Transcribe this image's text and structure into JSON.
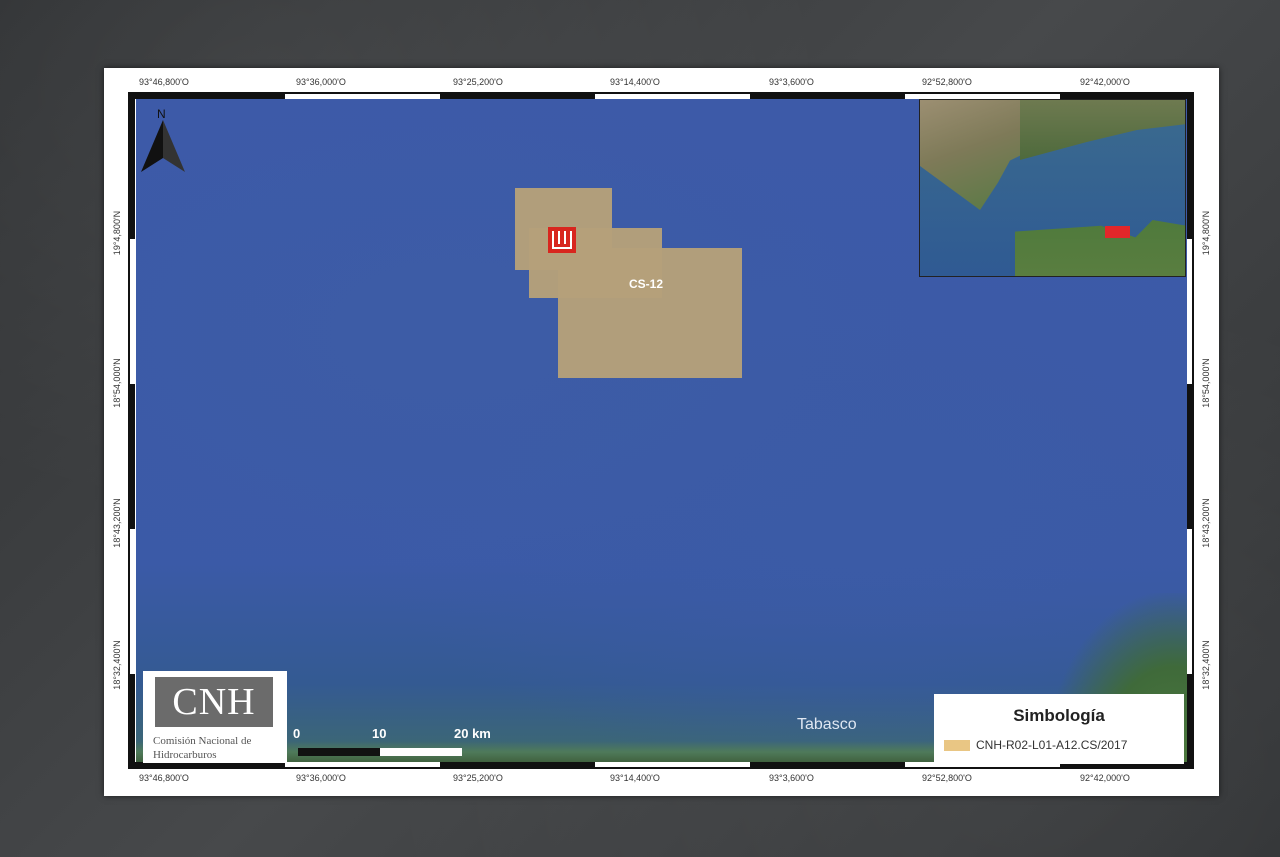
{
  "map": {
    "top_coords": [
      "93°46,800'O",
      "93°36,000'O",
      "93°25,200'O",
      "93°14,400'O",
      "93°3,600'O",
      "92°52,800'O",
      "92°42,000'O"
    ],
    "bottom_coords": [
      "93°46,800'O",
      "93°36,000'O",
      "93°25,200'O",
      "93°14,400'O",
      "93°3,600'O",
      "92°52,800'O",
      "92°42,000'O"
    ],
    "left_coords": [
      "19°4,800'N",
      "18°54,000'N",
      "18°43,200'N",
      "18°32,400'N"
    ],
    "right_coords": [
      "19°4,800'N",
      "18°54,000'N",
      "18°43,200'N",
      "18°32,400'N"
    ],
    "north_label": "N",
    "block_label": "CS-12",
    "place_label": "Tabasco",
    "colors": {
      "sea": "#3d5aa8",
      "block": "#b5a07a",
      "marker": "#e3262a"
    }
  },
  "scale": {
    "zero": "0",
    "ten": "10",
    "twenty": "20 km"
  },
  "logo": {
    "mark": "CNH",
    "name": "Comisión Nacional de Hidrocarburos"
  },
  "legend": {
    "title": "Simbología",
    "item": "CNH-R02-L01-A12.CS/2017",
    "item_color": "#e9c684"
  }
}
